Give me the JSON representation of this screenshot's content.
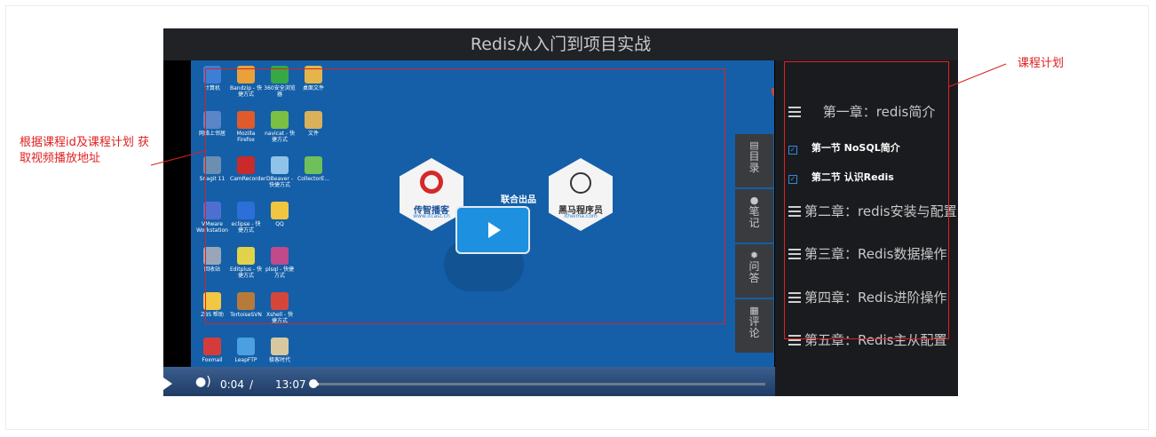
{
  "player": {
    "title": "Redis从入门到项目实战",
    "joint_text": "联合出品",
    "logo_left": {
      "name": "传智播客",
      "url": "www.itcast.cn"
    },
    "logo_right": {
      "name": "黑马程序员",
      "url": "itheima.com"
    },
    "time_current": "0:04",
    "time_sep": "/",
    "time_total": "13:07",
    "progress_fraction": 0.005
  },
  "desktop_icons": [
    {
      "label": "计算机"
    },
    {
      "label": "Bandzip - 快捷方式"
    },
    {
      "label": "360安全浏览器"
    },
    {
      "label": "桌面文件"
    },
    {
      "label": "网络上邻居"
    },
    {
      "label": "Mozilla Firefox"
    },
    {
      "label": "navicat - 快捷方式"
    },
    {
      "label": "文件"
    },
    {
      "label": "Snagit 11"
    },
    {
      "label": "CamRecorder"
    },
    {
      "label": "DBeaver - 快捷方式"
    },
    {
      "label": "CollectorE..."
    },
    {
      "label": "VMware Workstation"
    },
    {
      "label": "eclipse - 快捷方式"
    },
    {
      "label": "QQ"
    },
    {
      "label": "回收站"
    },
    {
      "label": "Editplus - 快捷方式"
    },
    {
      "label": "plsql - 快捷方式"
    },
    {
      "label": "ZBS 帮助"
    },
    {
      "label": "TortoiseSVN"
    },
    {
      "label": "Xshell - 快捷方式"
    },
    {
      "label": "Foxmail"
    },
    {
      "label": "LeapFTP"
    },
    {
      "label": "极客时代"
    }
  ],
  "side_tabs": [
    {
      "icon": "list-icon",
      "label": "目录"
    },
    {
      "icon": "user-icon",
      "label": "笔记"
    },
    {
      "icon": "gear-icon",
      "label": "问答"
    },
    {
      "icon": "comment-icon",
      "label": "评论"
    }
  ],
  "course_plan": {
    "chapters": [
      {
        "label": "第一章：redis简介",
        "sections": [
          "第一节 NoSQL简介",
          "第二节 认识Redis"
        ]
      },
      {
        "label": "第二章：redis安装与配置"
      },
      {
        "label": "第三章：Redis数据操作"
      },
      {
        "label": "第四章：Redis进阶操作"
      },
      {
        "label": "第五章：Redis主从配置"
      }
    ]
  },
  "annotations": {
    "left": "根据课程id及课程计划 获取视频播放地址",
    "right": "课程计划"
  },
  "colors": {
    "annotation": "#e02020",
    "desktop": "#145fa8",
    "play_button": "#1e90e0"
  }
}
